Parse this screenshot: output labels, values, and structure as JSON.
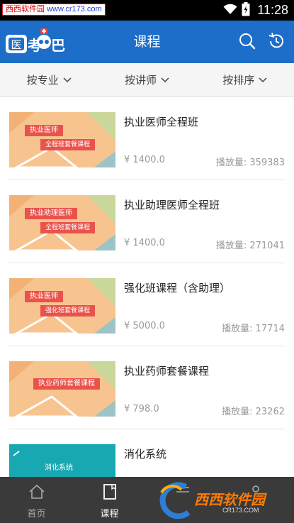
{
  "status_bar": {
    "watermark_site": "西西软件园",
    "watermark_url": "www.cr173.com",
    "time": "11:28"
  },
  "app_bar": {
    "logo_text": "医考吧",
    "title": "课程",
    "search_icon": "search-icon",
    "history_icon": "history-icon",
    "color": "#1c6ec9"
  },
  "filters": [
    {
      "label": "按专业"
    },
    {
      "label": "按讲师"
    },
    {
      "label": "按排序"
    }
  ],
  "courses": [
    {
      "name": "执业医师全程班",
      "thumb_line1": "执业医师",
      "thumb_line2": "全程班套餐课程",
      "price": "¥  1400.0",
      "plays": "播放量: 359383"
    },
    {
      "name": "执业助理医师全程班",
      "thumb_line1": "执业助理医师",
      "thumb_line2": "全程班套餐课程",
      "price": "¥  1400.0",
      "plays": "播放量: 271041"
    },
    {
      "name": "强化班课程（含助理）",
      "thumb_line1": "执业医师",
      "thumb_line2": "强化班套餐课程",
      "price": "¥  5000.0",
      "plays": "播放量: 17714"
    },
    {
      "name": "执业药师套餐课程",
      "thumb_line1": "执业药师套餐课程",
      "thumb_line2": "",
      "price": "¥  798.0",
      "plays": "播放量: 23262"
    },
    {
      "name": "消化系统",
      "thumb_line1": "消化系统",
      "thumb_line2": "",
      "price": "",
      "plays": ""
    }
  ],
  "bottom_nav": [
    {
      "label": "首页",
      "icon": "home-icon",
      "active": false
    },
    {
      "label": "课程",
      "icon": "course-icon",
      "active": true
    },
    {
      "label": "",
      "icon": "menu-icon",
      "active": false
    },
    {
      "label": "",
      "icon": "user-icon",
      "active": false
    }
  ],
  "bottom_watermark": {
    "text": "西西软件园",
    "url": "CR173.COM"
  },
  "colors": {
    "accent": "#1c6ec9",
    "thumb_bg": "#f7c48f",
    "ribbon": "#e9534c",
    "teal": "#17a8b2"
  }
}
